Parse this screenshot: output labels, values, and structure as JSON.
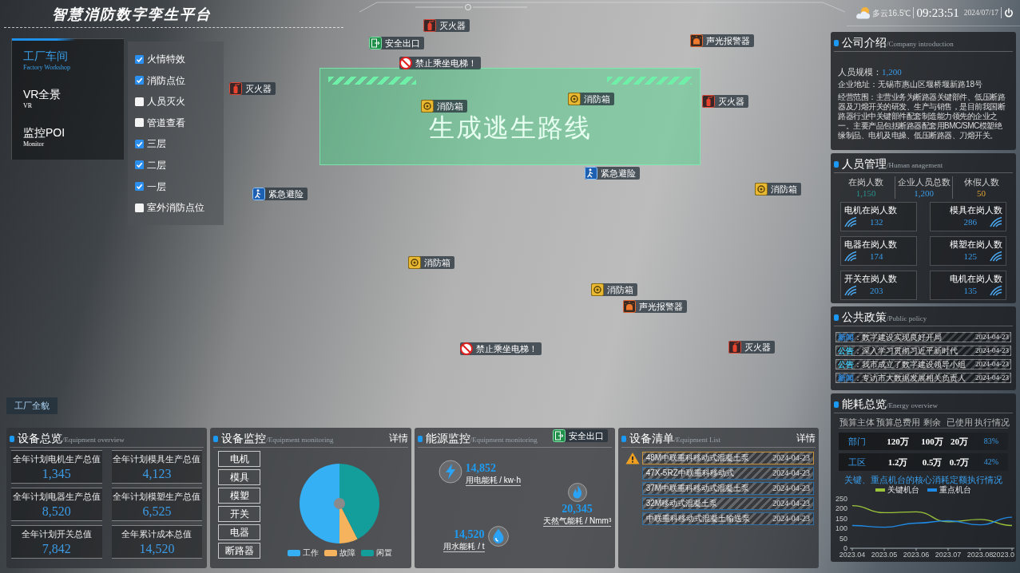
{
  "header": {
    "title": "智慧消防数字孪生平台",
    "weather": "多云16.5℃",
    "time": "09:23:51",
    "date": "2024/07/17"
  },
  "nav": [
    {
      "label": "工厂车间",
      "subtitle": "Factory Workshop",
      "selected": true
    },
    {
      "label": "VR全景",
      "subtitle": "VR",
      "selected": false
    },
    {
      "label": "监控POI",
      "subtitle": "Monitor",
      "selected": false
    }
  ],
  "layers": [
    {
      "label": "火情特效",
      "checked": true
    },
    {
      "label": "消防点位",
      "checked": true
    },
    {
      "label": "人员灭火",
      "checked": false
    },
    {
      "label": "管道查看",
      "checked": false
    },
    {
      "label": "三层",
      "checked": true
    },
    {
      "label": "二层",
      "checked": true
    },
    {
      "label": "一层",
      "checked": true
    },
    {
      "label": "室外消防点位",
      "checked": false
    }
  ],
  "overview_button": "工厂全貌",
  "scene": {
    "banner": "生成逃生路线",
    "markers": [
      {
        "kind": "extinguisher",
        "label": "灭火器"
      },
      {
        "kind": "exit",
        "label": "安全出口"
      },
      {
        "kind": "no_elevator",
        "label": "禁止乘坐电梯！"
      },
      {
        "kind": "alarm",
        "label": "声光报警器"
      },
      {
        "kind": "extinguisher",
        "label": "灭火器"
      },
      {
        "kind": "hose_box",
        "label": "消防箱"
      },
      {
        "kind": "hose_box",
        "label": "消防箱"
      },
      {
        "kind": "extinguisher",
        "label": "灭火器"
      },
      {
        "kind": "refuge",
        "label": "紧急避险"
      },
      {
        "kind": "refuge",
        "label": "紧急避险"
      },
      {
        "kind": "hose_box",
        "label": "消防箱"
      },
      {
        "kind": "hose_box",
        "label": "消防箱"
      },
      {
        "kind": "hose_box",
        "label": "消防箱"
      },
      {
        "kind": "alarm",
        "label": "声光报警器"
      },
      {
        "kind": "no_elevator",
        "label": "禁止乘坐电梯！"
      },
      {
        "kind": "extinguisher",
        "label": "灭火器"
      },
      {
        "kind": "exit",
        "label": "安全出口"
      }
    ]
  },
  "equipment_overview": {
    "title": "设备总览",
    "subtitle": "/Equipment overview",
    "cards": [
      {
        "label": "全年计划电机生产总值",
        "value": "1,345"
      },
      {
        "label": "全年计划模具生产总值",
        "value": "4,123"
      },
      {
        "label": "全年计划电器生产总值",
        "value": "8,520"
      },
      {
        "label": "全年计划模塑生产总值",
        "value": "6,525"
      },
      {
        "label": "全年计划开关总值",
        "value": "7,842"
      },
      {
        "label": "全年累计成本总值",
        "value": "14,520"
      }
    ]
  },
  "equipment_monitoring": {
    "title": "设备监控",
    "subtitle": "/Equipment monitoring",
    "detail": "详情",
    "categories": [
      "电机",
      "模具",
      "模塑",
      "开关",
      "电器",
      "断路器"
    ],
    "legend": [
      {
        "label": "工作",
        "color": "#35b0f5"
      },
      {
        "label": "故障",
        "color": "#f4b35c"
      },
      {
        "label": "闲置",
        "color": "#139e9c"
      }
    ]
  },
  "energy_monitoring": {
    "title": "能源监控",
    "subtitle": "/Equipment monitoring",
    "meters": [
      {
        "kind": "electricity",
        "value": "14,852",
        "label": "用电能耗 / kw·h"
      },
      {
        "kind": "gas",
        "value": "20,345",
        "label": "天然气能耗 / Nmm³"
      },
      {
        "kind": "water",
        "value": "14,520",
        "label": "用水能耗 / t"
      }
    ]
  },
  "equipment_list": {
    "title": "设备清单",
    "subtitle": "/Equipment List",
    "detail": "详情",
    "rows": [
      {
        "name": "48M中联重科移动式混凝土泵",
        "date": "2024-04-23",
        "alert": true
      },
      {
        "name": "47X-5RZ中联重科移动式",
        "date": "2024-04-23",
        "alert": false
      },
      {
        "name": "37M中联重科移动式混凝土泵",
        "date": "2024-04-23",
        "alert": false
      },
      {
        "name": "32M移动式混凝土泵",
        "date": "2024-04-23",
        "alert": false
      },
      {
        "name": "中联重科移动式混凝土输送泵",
        "date": "2024-04-23",
        "alert": false
      }
    ]
  },
  "company": {
    "title": "公司介绍",
    "subtitle": "/Company introduction",
    "fields": [
      {
        "kind": "number",
        "label": "人员规模：",
        "value": "1,200"
      },
      {
        "kind": "line",
        "label": "企业地址：",
        "value": "无锡市惠山区堰桥堰新路18号"
      },
      {
        "kind": "paragraph",
        "label": "经营范围：",
        "value": "主营业务为断路器关键部件、低压断路器及刀熔开关的研发、生产与销售，是目前我国断路器行业中关键部件配套制造能力领先的企业之一。主要产品包括断路器配套用BMC/SMC模塑绝缘制品、电机及电操、低压断路器、刀熔开关。"
      }
    ]
  },
  "personnel": {
    "title": "人员管理",
    "subtitle": "/Human anagement",
    "totals": [
      {
        "label": "在岗人数",
        "value": "1,150",
        "color": "#2a8f8c"
      },
      {
        "label": "企业人员总数",
        "value": "1,200",
        "color": "#3a9be8"
      },
      {
        "label": "休假人数",
        "value": "50",
        "color": "#e0a030"
      }
    ],
    "groups": [
      {
        "label": "电机在岗人数",
        "value": "132"
      },
      {
        "label": "模具在岗人数",
        "value": "286"
      },
      {
        "label": "电器在岗人数",
        "value": "174"
      },
      {
        "label": "模塑在岗人数",
        "value": "125"
      },
      {
        "label": "开关在岗人数",
        "value": "203"
      },
      {
        "label": "电机在岗人数",
        "value": "135"
      }
    ]
  },
  "policy": {
    "title": "公共政策",
    "subtitle": "/Public policy",
    "items": [
      {
        "tag": "新闻",
        "color": "#2f86d6",
        "text": "：数字建设实现良好开局",
        "date": "2024-04-23"
      },
      {
        "tag": "公告",
        "color": "#3fc1e8",
        "text": "：深入学习贯彻习近平新时代",
        "date": "2024-04-23"
      },
      {
        "tag": "公告",
        "color": "#3fc1e8",
        "text": "：我市成立了数字建设领导小组",
        "date": "2024-04-23"
      },
      {
        "tag": "新闻",
        "color": "#2f86d6",
        "text": "：专访市大数据发展相关负责人",
        "date": "2024-04-23"
      }
    ]
  },
  "energy_overview": {
    "title": "能耗总览",
    "subtitle": "/Energy overview",
    "columns": [
      "预算主体",
      "预算总费用",
      "剩余",
      "已使用",
      "执行情况"
    ],
    "rows": [
      [
        "部门",
        "120万",
        "100万",
        "20万",
        "83%"
      ],
      [
        "工区",
        "1.2万",
        "0.5万",
        "0.7万",
        "42%"
      ]
    ],
    "chart_data": {
      "type": "line",
      "title": "关键、重点机台的核心消耗定额执行情况",
      "legend": "top",
      "categories": [
        "2023.04",
        "2023.05",
        "2023.06",
        "2023.07",
        "2023.08",
        "2023.0"
      ],
      "series": [
        {
          "name": "关键机台",
          "color": "#9cc43a",
          "values": [
            215,
            180,
            184,
            134,
            146,
            115
          ]
        },
        {
          "name": "重点机台",
          "color": "#1e8ae6",
          "values": [
            115,
            106,
            127,
            139,
            118,
            157
          ]
        }
      ],
      "ylim": [
        0,
        250
      ],
      "yticks": [
        0,
        50,
        100,
        150,
        200,
        250
      ]
    }
  }
}
